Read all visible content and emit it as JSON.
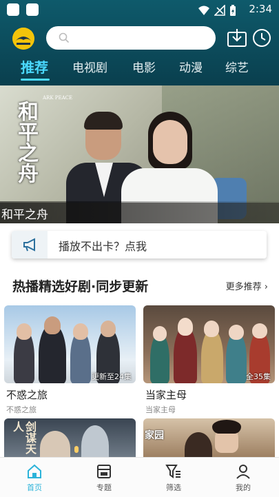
{
  "status_bar": {
    "time": "2:34"
  },
  "header": {
    "search_placeholder": "",
    "tabs": [
      {
        "label": "推荐",
        "active": true
      },
      {
        "label": "电视剧"
      },
      {
        "label": "电影"
      },
      {
        "label": "动漫"
      },
      {
        "label": "综艺"
      }
    ],
    "icons": [
      "app-logo-icon",
      "search-icon",
      "download-icon",
      "history-clock-icon"
    ]
  },
  "banner": {
    "title_art": "和平之舟",
    "title_art_en": "ARK PEACE",
    "caption": "和平之舟"
  },
  "notice": {
    "text": "播放不出卡？点我",
    "icon": "megaphone-icon"
  },
  "section": {
    "title": "热播精选好剧·同步更新",
    "more_label": "更多推荐 ›"
  },
  "cards": [
    {
      "title": "不惑之旅",
      "subtitle": "不惑之旅",
      "badge": "更新至24集"
    },
    {
      "title": "当家主母",
      "subtitle": "当家主母",
      "badge": "全35集"
    },
    {
      "title": "",
      "subtitle": "",
      "badge": "",
      "poster_text": "剑谋天人"
    },
    {
      "title": "",
      "subtitle": "",
      "badge": "",
      "poster_text": "家园"
    }
  ],
  "tabbar": [
    {
      "label": "首页",
      "icon": "home-icon",
      "active": true
    },
    {
      "label": "专题",
      "icon": "topic-icon"
    },
    {
      "label": "筛选",
      "icon": "filter-icon"
    },
    {
      "label": "我的",
      "icon": "profile-icon"
    }
  ],
  "colors": {
    "header_bg": "#0b4a5a",
    "accent": "#4ad9ff",
    "tab_active": "#2bb3d9"
  }
}
